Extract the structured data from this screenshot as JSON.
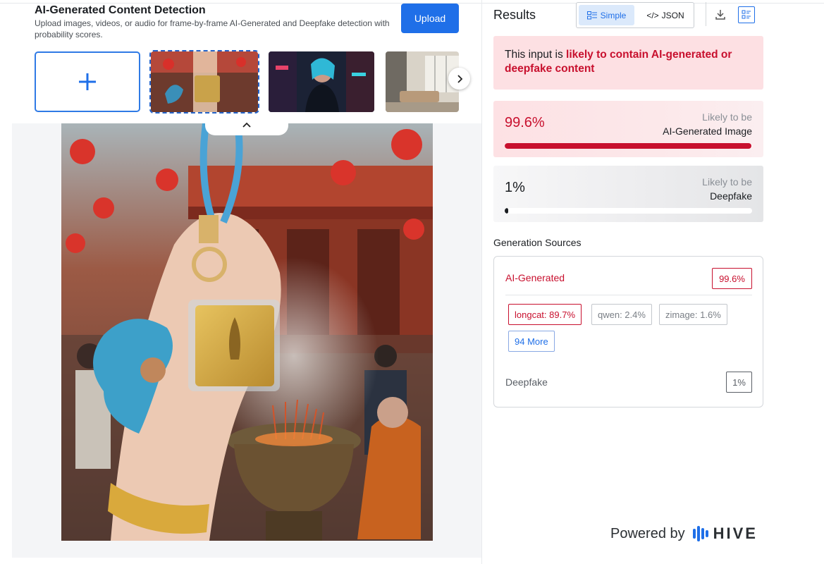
{
  "header": {
    "title": "AI-Generated Content Detection",
    "subtitle": "Upload images, videos, or audio for frame-by-frame AI-Generated and Deepfake detection with probability scores.",
    "upload_label": "Upload"
  },
  "thumbnails": {
    "items": [
      {
        "name": "temple-keychain",
        "selected": true
      },
      {
        "name": "cyberpunk-woman",
        "selected": false
      },
      {
        "name": "interior-room",
        "selected": false
      }
    ]
  },
  "results": {
    "title": "Results",
    "view_simple": "Simple",
    "view_json": "JSON",
    "verdict_prefix": "This input is ",
    "verdict_highlight": "likely to contain AI-generated or deepfake content",
    "ai_score": {
      "value": "99.6%",
      "fraction": 0.996,
      "label_top": "Likely to be",
      "label_bottom": "AI-Generated Image"
    },
    "deepfake_score": {
      "value": "1%",
      "fraction": 0.01,
      "label_top": "Likely to be",
      "label_bottom": "Deepfake"
    },
    "generation_sources": {
      "title": "Generation Sources",
      "ai_label": "AI-Generated",
      "ai_value": "99.6%",
      "chips": [
        "longcat: 89.7%",
        "qwen: 2.4%",
        "zimage: 1.6%"
      ],
      "more_label": "94 More",
      "deepfake_label": "Deepfake",
      "deepfake_value": "1%"
    }
  },
  "footer": {
    "powered_by": "Powered by",
    "brand": "HIVE"
  },
  "colors": {
    "accent": "#1f6fe8",
    "danger": "#c8102e"
  }
}
